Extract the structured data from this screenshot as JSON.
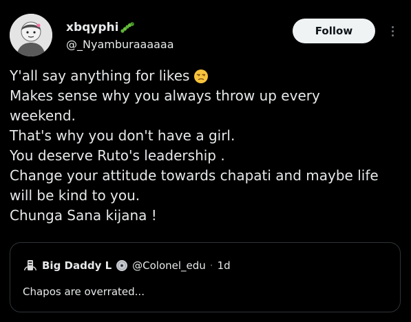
{
  "colors": {
    "background": "#000000",
    "text": "#e7e9ea",
    "muted": "#71767b",
    "border": "#2f3336",
    "follow_bg": "#eff3f4",
    "follow_text": "#0f1419"
  },
  "author": {
    "display_name": "xbqyphi",
    "name_emoji": "caterpillar-emoji",
    "handle": "@_Nyamburaaaaaa",
    "avatar_icon": "avatar-sticker"
  },
  "actions": {
    "follow_label": "Follow",
    "more_icon": "more-vertical-icon"
  },
  "tweet": {
    "lines": [
      "Y'all say anything for likes",
      "Makes sense why you always throw up every",
      "weekend.",
      "That's why you don't have a girl.",
      "You deserve Ruto's leadership .",
      "Change your attitude towards chapati and maybe life",
      "will be kind to you.",
      "Chunga Sana  kijana !"
    ],
    "line0_emoji": "unamused-face-emoji"
  },
  "quote": {
    "display_name": "Big Daddy L",
    "name_emoji": "disc-emoji",
    "handle": "@Colonel_edu",
    "separator": "·",
    "time": "1d",
    "text": "Chapos are overrated..."
  }
}
